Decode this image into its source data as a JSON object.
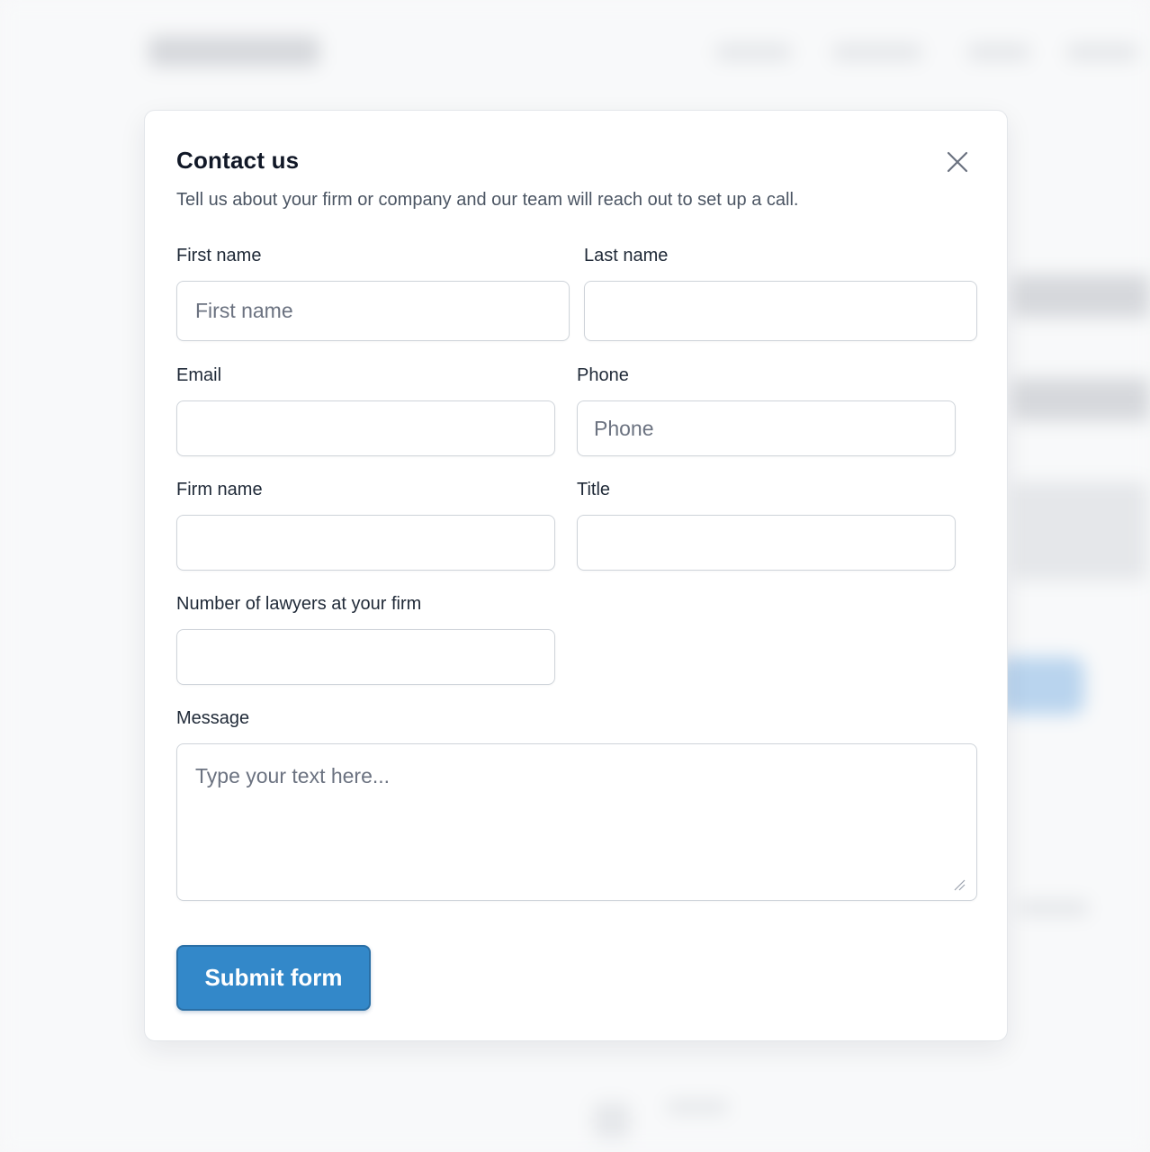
{
  "modal": {
    "title": "Contact us",
    "subtitle": "Tell us about your firm or company and our team will reach out to set up a call.",
    "close_icon": "close-icon"
  },
  "form": {
    "first_name": {
      "label": "First name",
      "placeholder": "First name",
      "value": ""
    },
    "last_name": {
      "label": "Last name",
      "placeholder": "",
      "value": ""
    },
    "email": {
      "label": "Email",
      "placeholder": "",
      "value": ""
    },
    "phone": {
      "label": "Phone",
      "placeholder": "Phone",
      "value": ""
    },
    "firm_name": {
      "label": "Firm name",
      "placeholder": "",
      "value": ""
    },
    "title": {
      "label": "Title",
      "placeholder": "",
      "value": ""
    },
    "lawyers": {
      "label": "Number of lawyers at your firm",
      "placeholder": "",
      "value": ""
    },
    "message": {
      "label": "Message",
      "placeholder": "Type your text here...",
      "value": ""
    },
    "submit_label": "Submit form"
  },
  "colors": {
    "accent": "#3388c9",
    "accent_border": "#2a6fa6",
    "text": "#1f2937",
    "muted": "#4b5563",
    "border": "#cfd4da"
  }
}
